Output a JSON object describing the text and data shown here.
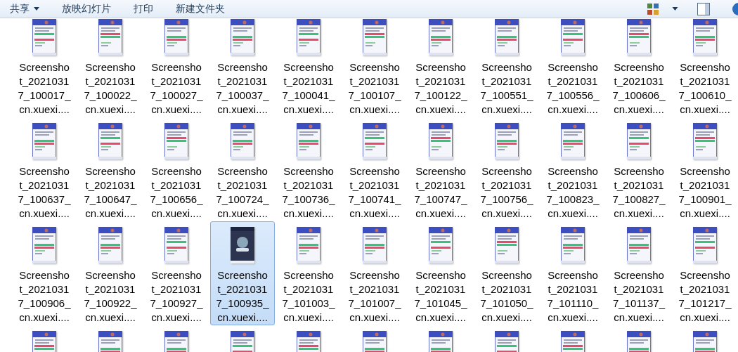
{
  "toolbar": {
    "buttons": [
      {
        "label": "共享",
        "dropdown": true
      },
      {
        "label": "放映幻灯片",
        "dropdown": false
      },
      {
        "label": "打印",
        "dropdown": false
      },
      {
        "label": "新建文件夹",
        "dropdown": false
      }
    ]
  },
  "files": [
    {
      "name": "Screenshot_20210317_100017_cn.xuexi....",
      "selected": false
    },
    {
      "name": "Screenshot_20210317_100022_cn.xuexi....",
      "selected": false
    },
    {
      "name": "Screenshot_20210317_100027_cn.xuexi....",
      "selected": false
    },
    {
      "name": "Screenshot_20210317_100037_cn.xuexi....",
      "selected": false
    },
    {
      "name": "Screenshot_20210317_100041_cn.xuexi....",
      "selected": false
    },
    {
      "name": "Screenshot_20210317_100107_cn.xuexi....",
      "selected": false
    },
    {
      "name": "Screenshot_20210317_100122_cn.xuexi....",
      "selected": false
    },
    {
      "name": "Screenshot_20210317_100551_cn.xuexi....",
      "selected": false
    },
    {
      "name": "Screenshot_20210317_100556_cn.xuexi....",
      "selected": false
    },
    {
      "name": "Screenshot_20210317_100606_cn.xuexi....",
      "selected": false
    },
    {
      "name": "Screenshot_20210317_100610_cn.xuexi....",
      "selected": false
    },
    {
      "name": "Screenshot_20210317_100637_cn.xuexi....",
      "selected": false
    },
    {
      "name": "Screenshot_20210317_100647_cn.xuexi....",
      "selected": false
    },
    {
      "name": "Screenshot_20210317_100656_cn.xuexi....",
      "selected": false
    },
    {
      "name": "Screenshot_20210317_100724_cn.xuexi....",
      "selected": false
    },
    {
      "name": "Screenshot_20210317_100736_cn.xuexi....",
      "selected": false
    },
    {
      "name": "Screenshot_20210317_100741_cn.xuexi....",
      "selected": false
    },
    {
      "name": "Screenshot_20210317_100747_cn.xuexi....",
      "selected": false
    },
    {
      "name": "Screenshot_20210317_100756_cn.xuexi....",
      "selected": false
    },
    {
      "name": "Screenshot_20210317_100823_cn.xuexi....",
      "selected": false
    },
    {
      "name": "Screenshot_20210317_100827_cn.xuexi....",
      "selected": false
    },
    {
      "name": "Screenshot_20210317_100901_cn.xuexi....",
      "selected": false
    },
    {
      "name": "Screenshot_20210317_100906_cn.xuexi....",
      "selected": false
    },
    {
      "name": "Screenshot_20210317_100922_cn.xuexi....",
      "selected": false
    },
    {
      "name": "Screenshot_20210317_100927_cn.xuexi....",
      "selected": false
    },
    {
      "name": "Screenshot_20210317_100935_cn.xuexi....",
      "selected": true
    },
    {
      "name": "Screenshot_20210317_101003_cn.xuexi....",
      "selected": false
    },
    {
      "name": "Screenshot_20210317_101007_cn.xuexi....",
      "selected": false
    },
    {
      "name": "Screenshot_20210317_101045_cn.xuexi....",
      "selected": false
    },
    {
      "name": "Screenshot_20210317_101050_cn.xuexi....",
      "selected": false
    },
    {
      "name": "Screenshot_20210317_101110_cn.xuexi....",
      "selected": false
    },
    {
      "name": "Screenshot_20210317_101137_cn.xuexi....",
      "selected": false
    },
    {
      "name": "Screenshot_20210317_101217_cn.xuexi....",
      "selected": false
    },
    {
      "selected": false
    },
    {
      "selected": false
    },
    {
      "selected": false
    },
    {
      "selected": false
    },
    {
      "selected": false
    },
    {
      "selected": false
    },
    {
      "selected": false
    },
    {
      "selected": false
    },
    {
      "selected": false
    },
    {
      "selected": false
    },
    {
      "selected": false
    }
  ]
}
